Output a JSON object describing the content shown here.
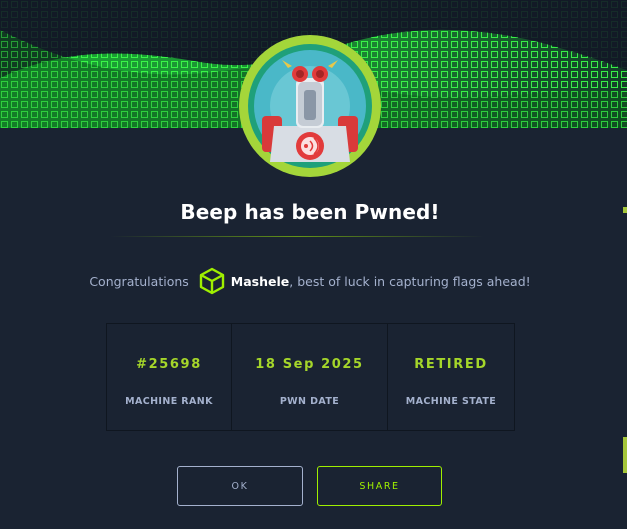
{
  "modal": {
    "title": "Beep has been Pwned!",
    "congrats_prefix": "Congratulations",
    "username": "Mashele",
    "congrats_suffix": ", best of luck in capturing flags ahead!"
  },
  "stats": [
    {
      "value": "#25698",
      "label": "MACHINE RANK"
    },
    {
      "value": "18 Sep 2025",
      "label": "PWN DATE"
    },
    {
      "value": "RETIRED",
      "label": "MACHINE STATE"
    }
  ],
  "buttons": {
    "ok_label": "OK",
    "share_label": "SHARE"
  },
  "icons": {
    "user": "cube-icon",
    "avatar": "machine-avatar-icon"
  },
  "colors": {
    "accent": "#9fef00",
    "background": "#1a2332",
    "muted_text": "#a4b1cd"
  }
}
